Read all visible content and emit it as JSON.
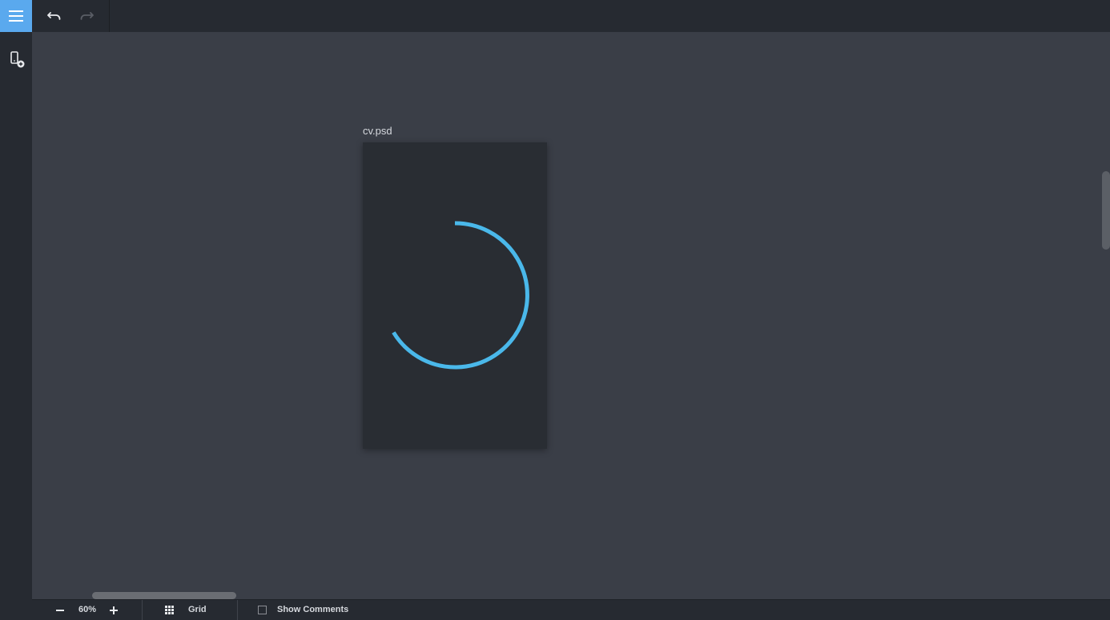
{
  "toolbar": {
    "menu_icon": "hamburger-icon",
    "undo_icon": "undo-icon",
    "redo_icon": "redo-icon"
  },
  "sidebar": {
    "add_device_icon": "phone-add-icon"
  },
  "artboard": {
    "title": "cv.psd",
    "loading": true,
    "spinner_color": "#4ab8ea"
  },
  "statusbar": {
    "zoom_out_icon": "minus-icon",
    "zoom_level": "60%",
    "zoom_in_icon": "plus-icon",
    "grid_icon": "grid-icon",
    "grid_label": "Grid",
    "show_comments_label": "Show Comments",
    "show_comments_checked": false
  },
  "colors": {
    "accent": "#5aa9ee",
    "chrome": "#262a31",
    "canvas": "#3a3e47",
    "artboard": "#292d33"
  }
}
